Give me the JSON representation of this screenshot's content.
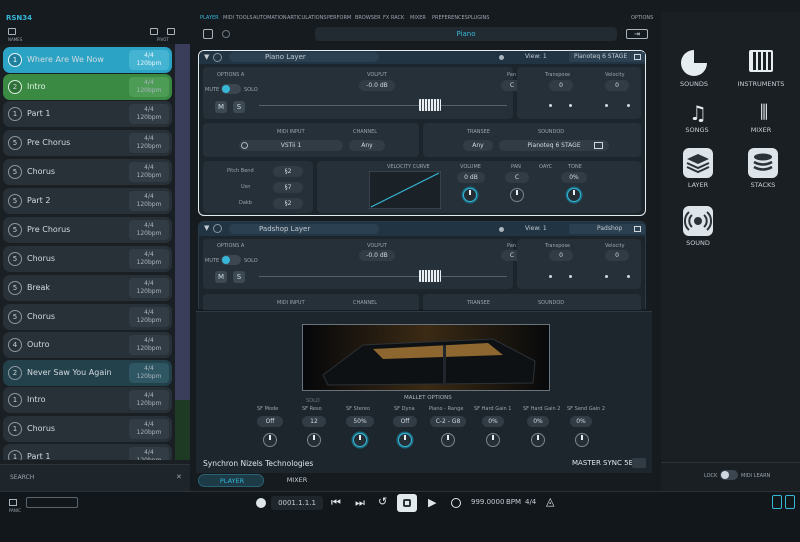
{
  "app": {
    "logo": "RSN34",
    "names_label": "NAMES",
    "pivot_label": "PIVOT"
  },
  "colors": {
    "accent": "#2aa3c4",
    "green": "#3a8a44",
    "panel": "#1d252c"
  },
  "songs": [
    {
      "num": "1",
      "name": "Where Are We Now",
      "sig": "4/4",
      "bpm": "120bpm"
    },
    {
      "num": "2",
      "name": "Intro",
      "sig": "4/4",
      "bpm": "120bpm"
    },
    {
      "num": "1",
      "name": "Part 1",
      "sig": "4/4",
      "bpm": "120bpm"
    },
    {
      "num": "5",
      "name": "Pre Chorus",
      "sig": "4/4",
      "bpm": "120bpm"
    },
    {
      "num": "5",
      "name": "Chorus",
      "sig": "4/4",
      "bpm": "120bpm"
    },
    {
      "num": "5",
      "name": "Part 2",
      "sig": "4/4",
      "bpm": "120bpm"
    },
    {
      "num": "5",
      "name": "Pre Chorus",
      "sig": "4/4",
      "bpm": "120bpm"
    },
    {
      "num": "5",
      "name": "Chorus",
      "sig": "4/4",
      "bpm": "120bpm"
    },
    {
      "num": "5",
      "name": "Break",
      "sig": "4/4",
      "bpm": "120bpm"
    },
    {
      "num": "5",
      "name": "Chorus",
      "sig": "4/4",
      "bpm": "120bpm"
    },
    {
      "num": "4",
      "name": "Outro",
      "sig": "4/4",
      "bpm": "120bpm"
    },
    {
      "num": "2",
      "name": "Never Saw You Again",
      "sig": "4/4",
      "bpm": "120bpm"
    },
    {
      "num": "1",
      "name": "Intro",
      "sig": "4/4",
      "bpm": "120bpm"
    },
    {
      "num": "1",
      "name": "Chorus",
      "sig": "4/4",
      "bpm": "120bpm"
    },
    {
      "num": "1",
      "name": "Part 1",
      "sig": "4/4",
      "bpm": "120bpm"
    }
  ],
  "search": {
    "label": "SEARCH"
  },
  "menu": [
    "PLAYER",
    "MIDI TOOLS",
    "AUTOMATION",
    "ARTICULATIONS",
    "PERFORM",
    "BROWSER",
    "FX RACK",
    "MIXER",
    "PREFERENCES",
    "PLUGINS"
  ],
  "options_label": "OPTIONS",
  "preset_bar": {
    "name": "Piano"
  },
  "layer1": {
    "title": "Piano Layer",
    "view": "View: 1",
    "instrument": "Pianoteq 6 STAGE",
    "options": "OPTIONS A",
    "mute": "MUTE",
    "solo": "SOLO",
    "m": "M",
    "s": "S",
    "volume_label": "VOLPUT",
    "volume_val": "-0.0 dB",
    "pan_label": "Pan",
    "pan_val": "C",
    "transpose_label": "Transpose",
    "transpose_val": "0",
    "velocity_label": "Velocity",
    "velocity_val": "0",
    "midi_input_label": "MIDI INPUT",
    "midi_input_val": "VSTii 1",
    "channel_label": "CHANNEL",
    "channel_val": "Any",
    "transee_label": "TRANSEE",
    "transee_val": "Any",
    "sound_label": "SOUNDOD",
    "sound_val": "Pianoteq 6 STAGE",
    "rows": [
      {
        "label": "Pitch Bend",
        "val": "§2"
      },
      {
        "label": "Usn",
        "val": "§7"
      },
      {
        "label": "Dakb",
        "val": "§2"
      }
    ],
    "curve_label": "VELOCITY CURVE",
    "k_volume": "VOLUME",
    "k_volume_val": "0 dB",
    "k_pan": "PAN",
    "k_pan_val": "C",
    "k_oayc": "OAYC",
    "k_tone": "TONE",
    "k_tone_val": "0%"
  },
  "layer2": {
    "title": "Padshop Layer",
    "view": "View: 1",
    "instrument": "Padshop",
    "options": "OPTIONS A",
    "mute": "MUTE",
    "solo": "SOLO",
    "m": "M",
    "s": "S",
    "volume_label": "VOLPUT",
    "volume_val": "-0.0 dB",
    "pan_label": "Pan",
    "pan_val": "C",
    "transpose_label": "Transpose",
    "transpose_val": "0",
    "velocity_label": "Velocity",
    "velocity_val": "0",
    "midi_input_label": "MIDI INPUT",
    "channel_label": "CHANNEL",
    "transee_label": "TRANSEE",
    "sound_label": "SOUNDOD"
  },
  "mallet": {
    "label": "MALLET OPTIONS",
    "params": [
      {
        "name": "SF Mode",
        "val": "Off"
      },
      {
        "name": "SF Reso",
        "val": "12"
      },
      {
        "name": "SF Stereo",
        "val": "50%"
      },
      {
        "name": "SF Dyna",
        "val": "Off"
      },
      {
        "name": "Piano - Range",
        "val": "C-2 - G8"
      },
      {
        "name": "SF Hard Gain 1",
        "val": "0%"
      },
      {
        "name": "SF Hard Gain 2",
        "val": "0%"
      },
      {
        "name": "SF Send Gain 2",
        "val": "0%"
      }
    ]
  },
  "vendor": "Synchron Nizels Technologies",
  "master": "MASTER SYNC 5E",
  "bottom_tabs": [
    "PLAYER",
    "MIXER"
  ],
  "transport": {
    "position": "0001.1.1.1",
    "tempo": "999.0000",
    "bpm_label": "BPM",
    "signature": "4/4"
  },
  "right": {
    "items": [
      {
        "label": "SOUNDS"
      },
      {
        "label": "INSTRUMENTS"
      },
      {
        "label": "SONGS"
      },
      {
        "label": "MIXER"
      },
      {
        "label": "LAYER"
      },
      {
        "label": "STACKS"
      },
      {
        "label": "SOUND"
      }
    ],
    "lock": "LOCK",
    "midi_learn": "MIDI LEARN"
  }
}
